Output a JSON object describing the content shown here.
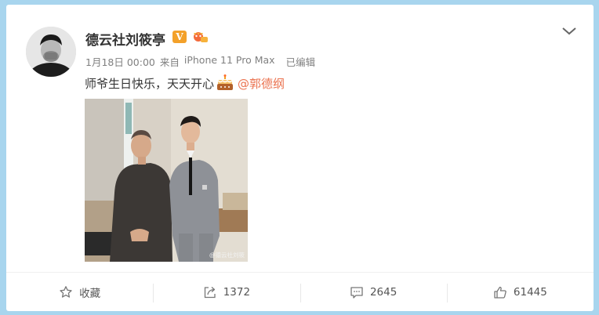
{
  "post": {
    "author": "德云社刘筱亭",
    "timestamp": "1月18日 00:00",
    "source_prefix": "来自",
    "device": "iPhone 11 Pro Max",
    "edited": "已编辑",
    "text": "师爷生日快乐，天天开心",
    "mention": "@郭德纲",
    "image_watermark": "@德云社刘筱",
    "verified_badge": "V"
  },
  "actions": {
    "favorite_label": "收藏",
    "repost_count": "1372",
    "comment_count": "2645",
    "like_count": "61445"
  },
  "icons": {
    "menu": "chevron-down-icon",
    "favorite": "star-icon",
    "repost": "share-arrow-icon",
    "comment": "comment-bubble-icon",
    "like": "thumbs-up-icon",
    "cake": "birthday-cake-icon"
  },
  "colors": {
    "background": "#a8d5ee",
    "mention": "#eb7350",
    "verified": "#f3a12a"
  }
}
